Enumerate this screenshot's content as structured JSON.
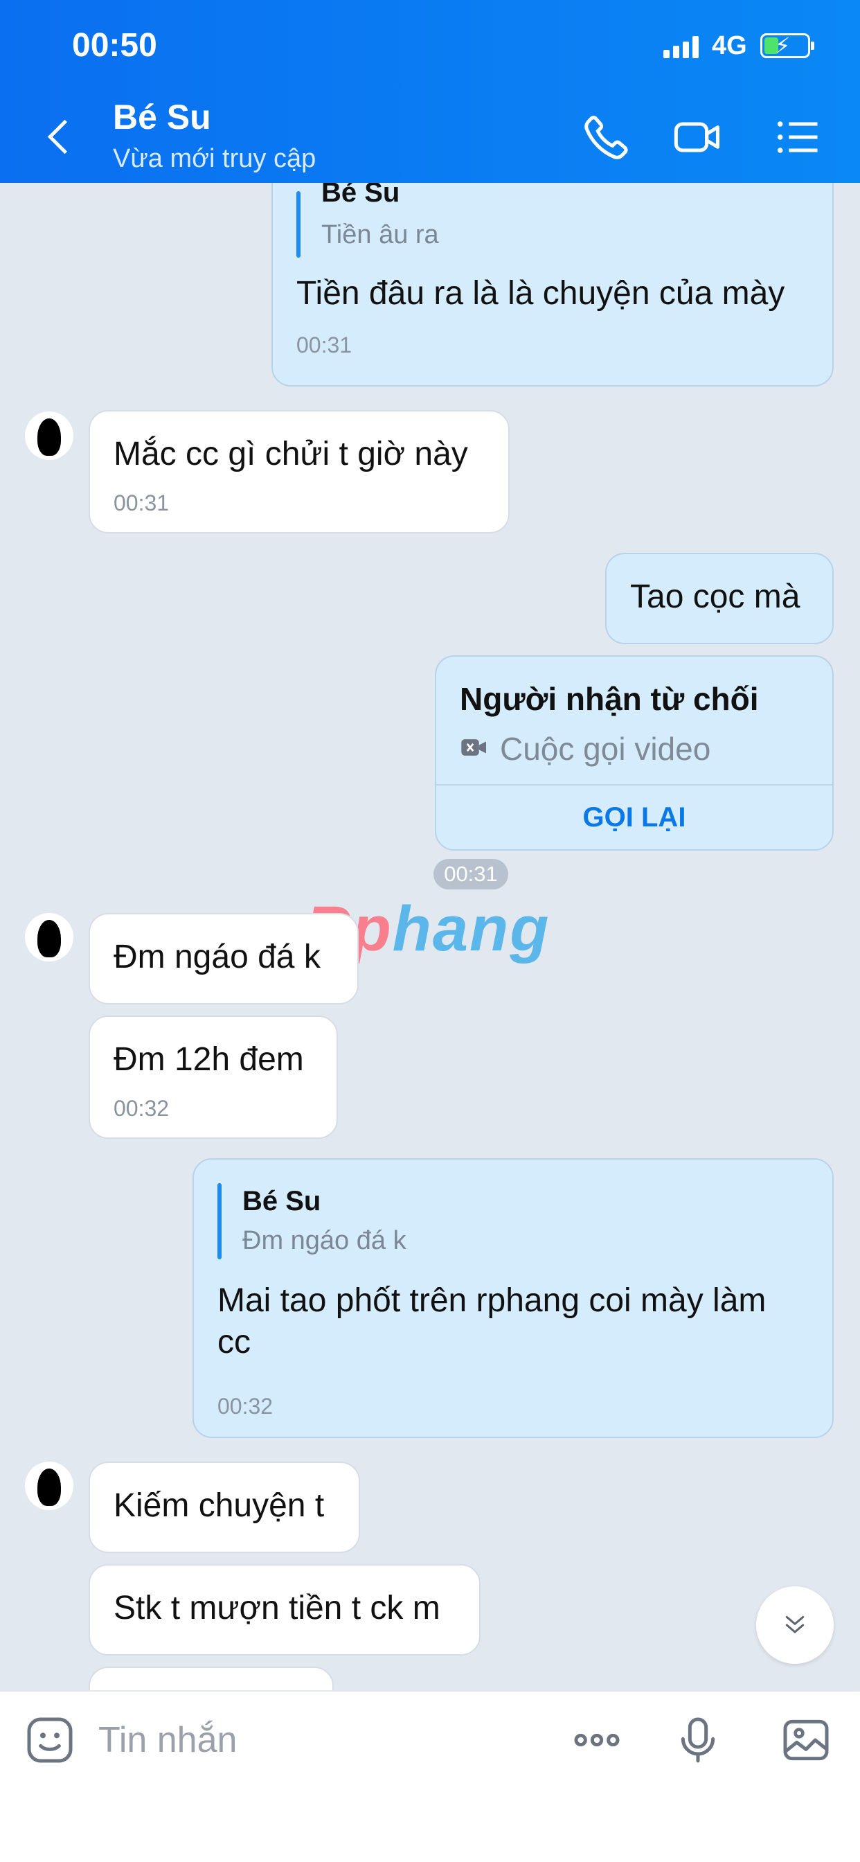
{
  "status": {
    "time": "00:50",
    "network": "4G"
  },
  "header": {
    "name": "Bé Su",
    "status": "Vừa mới truy cập"
  },
  "messages": {
    "m1": {
      "quote_name": "Bé Su",
      "quote_text": "Tiền âu ra",
      "text": "Tiền đâu ra là là chuyện của mày",
      "time": "00:31"
    },
    "m2": {
      "text": "Mắc cc gì chửi t giờ này",
      "time": "00:31"
    },
    "m3": {
      "text": "Tao cọc mà"
    },
    "call": {
      "title": "Người nhận từ chối",
      "subtitle": "Cuộc gọi video",
      "action": "GỌI LẠI",
      "time": "00:31"
    },
    "m4": {
      "text": "Đm ngáo đá k"
    },
    "m5": {
      "text": "Đm 12h đem",
      "time": "00:32"
    },
    "m6": {
      "quote_name": "Bé Su",
      "quote_text": "Đm ngáo đá k",
      "text_line1": "Mai tao phốt trên rphang coi mày làm",
      "text_line2": "cc",
      "time": "00:32"
    },
    "m7": {
      "text": "Kiếm chuyện t"
    },
    "m8": {
      "text": "Stk t mượn tiền t ck m"
    }
  },
  "watermark": {
    "part1": "Rp",
    "part2": "hang"
  },
  "input": {
    "placeholder": "Tin nhắn"
  },
  "icons": {
    "back": "back-arrow-icon",
    "phone": "phone-icon",
    "video": "video-camera-icon",
    "menu": "menu-list-icon",
    "sticker": "sticker-icon",
    "more": "more-dots-icon",
    "mic": "microphone-icon",
    "image": "image-icon",
    "scroll": "chevron-double-down-icon"
  },
  "colors": {
    "header": "#0a78ef",
    "my_bubble": "#d5ecfc",
    "their_bubble": "#ffffff",
    "accent": "#0a78e6"
  }
}
